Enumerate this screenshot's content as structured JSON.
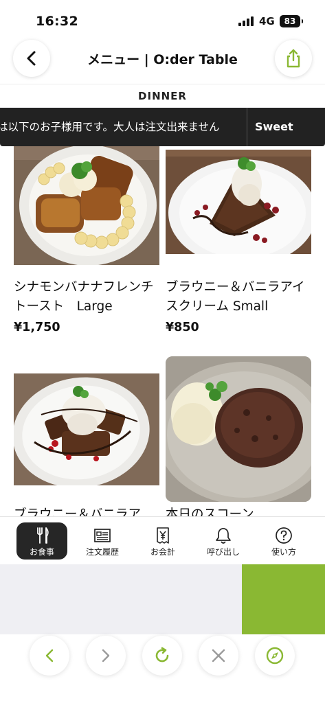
{
  "status": {
    "time": "16:32",
    "network": "4G",
    "battery": "83"
  },
  "header": {
    "title": "メニュー | O:der Table"
  },
  "category": {
    "label": "DINNER"
  },
  "banner": {
    "notice": "は以下のお子様用です。大人は注文出来ません",
    "tab_label": "Sweet"
  },
  "menu_items": [
    {
      "name": "シナモンバナナフレンチトースト　Large",
      "price": "¥1,750"
    },
    {
      "name": "ブラウニー＆バニラアイスクリーム Small",
      "price": "¥850"
    },
    {
      "name": "ブラウニー＆バニラア",
      "price": ""
    },
    {
      "name": "本日のスコーン",
      "price": ""
    }
  ],
  "tabbar": {
    "items": [
      {
        "label": "お食事",
        "icon": "fork-knife-icon",
        "active": true
      },
      {
        "label": "注文履歴",
        "icon": "receipt-list-icon",
        "active": false
      },
      {
        "label": "お会計",
        "icon": "yen-receipt-icon",
        "active": false
      },
      {
        "label": "呼び出し",
        "icon": "bell-icon",
        "active": false
      },
      {
        "label": "使い方",
        "icon": "help-icon",
        "active": false
      }
    ]
  },
  "browser_toolbar": {
    "buttons": [
      "back-icon",
      "forward-icon",
      "reload-icon",
      "close-icon",
      "compass-icon"
    ]
  },
  "colors": {
    "accent": "#8ab833",
    "dark": "#222222"
  }
}
